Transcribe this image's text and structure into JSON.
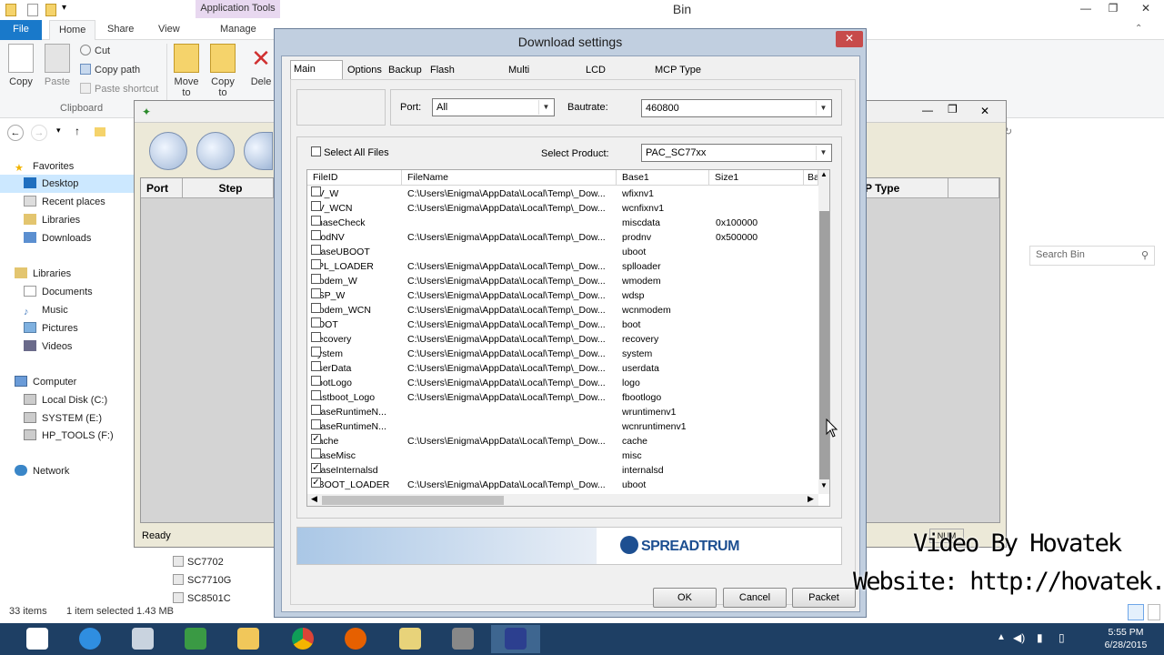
{
  "explorer": {
    "window_title": "Bin",
    "context_tab": "Application Tools",
    "ribbon_tabs": [
      "File",
      "Home",
      "Share",
      "View",
      "Manage"
    ],
    "clipboard": {
      "copy": "Copy",
      "paste": "Paste",
      "cut": "Cut",
      "copy_path": "Copy path",
      "paste_shortcut": "Paste shortcut",
      "group": "Clipboard"
    },
    "organize": {
      "move_to": "Move to",
      "copy_to": "Copy to",
      "delete": "Dele"
    },
    "search_placeholder": "Search Bin",
    "nav": {
      "favorites": "Favorites",
      "favorites_items": [
        "Desktop",
        "Recent places",
        "Libraries",
        "Downloads"
      ],
      "libraries": "Libraries",
      "libraries_items": [
        "Documents",
        "Music",
        "Pictures",
        "Videos"
      ],
      "computer": "Computer",
      "computer_items": [
        "Local Disk (C:)",
        "SYSTEM (E:)",
        "HP_TOOLS (F:)"
      ],
      "network": "Network"
    },
    "files": [
      "SC7702",
      "SC7710G",
      "SC8501C"
    ],
    "status": {
      "items": "33 items",
      "selected": "1 item selected  1.43 MB"
    }
  },
  "research_tool": {
    "grid_headers": [
      "Port",
      "Step"
    ],
    "type_header": "Type",
    "type_prefix": "P",
    "status": "Ready",
    "num_indicator": "NUM"
  },
  "dialog": {
    "title": "Download settings",
    "tabs": [
      "Main Page",
      "Options",
      "Backup",
      "Flash Operations",
      "Multi Languages",
      "LCD Configure",
      "MCP Type"
    ],
    "active_tab": "Main Page",
    "port_label": "Port:",
    "port_value": "All",
    "baudrate_label": "Bautrate:",
    "baudrate_value": "460800",
    "select_all_label": "Select All Files",
    "select_product_label": "Select Product:",
    "product_value": "PAC_SC77xx",
    "columns": [
      "FileID",
      "FileName",
      "Base1",
      "Size1",
      "Ba"
    ],
    "rows": [
      {
        "id": "NV_W",
        "file": "C:\\Users\\Enigma\\AppData\\Local\\Temp\\_Dow...",
        "base": "wfixnv1",
        "size": "",
        "checked": false
      },
      {
        "id": "NV_WCN",
        "file": "C:\\Users\\Enigma\\AppData\\Local\\Temp\\_Dow...",
        "base": "wcnfixnv1",
        "size": "",
        "checked": false
      },
      {
        "id": "PhaseCheck",
        "file": "",
        "base": "miscdata",
        "size": "0x100000",
        "checked": false
      },
      {
        "id": "ProdNV",
        "file": "C:\\Users\\Enigma\\AppData\\Local\\Temp\\_Dow...",
        "base": "prodnv",
        "size": "0x500000",
        "checked": false
      },
      {
        "id": "EraseUBOOT",
        "file": "",
        "base": "uboot",
        "size": "",
        "checked": false
      },
      {
        "id": "SPL_LOADER",
        "file": "C:\\Users\\Enigma\\AppData\\Local\\Temp\\_Dow...",
        "base": "splloader",
        "size": "",
        "checked": false
      },
      {
        "id": "Modem_W",
        "file": "C:\\Users\\Enigma\\AppData\\Local\\Temp\\_Dow...",
        "base": "wmodem",
        "size": "",
        "checked": false
      },
      {
        "id": "DSP_W",
        "file": "C:\\Users\\Enigma\\AppData\\Local\\Temp\\_Dow...",
        "base": "wdsp",
        "size": "",
        "checked": false
      },
      {
        "id": "Modem_WCN",
        "file": "C:\\Users\\Enigma\\AppData\\Local\\Temp\\_Dow...",
        "base": "wcnmodem",
        "size": "",
        "checked": false
      },
      {
        "id": "BOOT",
        "file": "C:\\Users\\Enigma\\AppData\\Local\\Temp\\_Dow...",
        "base": "boot",
        "size": "",
        "checked": false
      },
      {
        "id": "Recovery",
        "file": "C:\\Users\\Enigma\\AppData\\Local\\Temp\\_Dow...",
        "base": "recovery",
        "size": "",
        "checked": false
      },
      {
        "id": "System",
        "file": "C:\\Users\\Enigma\\AppData\\Local\\Temp\\_Dow...",
        "base": "system",
        "size": "",
        "checked": false
      },
      {
        "id": "UserData",
        "file": "C:\\Users\\Enigma\\AppData\\Local\\Temp\\_Dow...",
        "base": "userdata",
        "size": "",
        "checked": false
      },
      {
        "id": "BootLogo",
        "file": "C:\\Users\\Enigma\\AppData\\Local\\Temp\\_Dow...",
        "base": "logo",
        "size": "",
        "checked": false
      },
      {
        "id": "Fastboot_Logo",
        "file": "C:\\Users\\Enigma\\AppData\\Local\\Temp\\_Dow...",
        "base": "fbootlogo",
        "size": "",
        "checked": false
      },
      {
        "id": "EraseRuntimeN...",
        "file": "",
        "base": "wruntimenv1",
        "size": "",
        "checked": false
      },
      {
        "id": "EraseRuntimeN...",
        "file": "",
        "base": "wcnruntimenv1",
        "size": "",
        "checked": false
      },
      {
        "id": "Cache",
        "file": "C:\\Users\\Enigma\\AppData\\Local\\Temp\\_Dow...",
        "base": "cache",
        "size": "",
        "checked": true
      },
      {
        "id": "EraseMisc",
        "file": "",
        "base": "misc",
        "size": "",
        "checked": false
      },
      {
        "id": "EraseInternalsd",
        "file": "",
        "base": "internalsd",
        "size": "",
        "checked": true
      },
      {
        "id": "UBOOT_LOADER",
        "file": "C:\\Users\\Enigma\\AppData\\Local\\Temp\\_Dow...",
        "base": "uboot",
        "size": "",
        "checked": true
      }
    ],
    "brand": "SPREADTRUM",
    "buttons": {
      "ok": "OK",
      "cancel": "Cancel",
      "packet": "Packet"
    }
  },
  "watermark": {
    "line1": "Video By Hovatek",
    "line2": "Website: http://hovatek.com"
  },
  "taskbar": {
    "time": "5:55 PM",
    "date": "6/28/2015"
  }
}
